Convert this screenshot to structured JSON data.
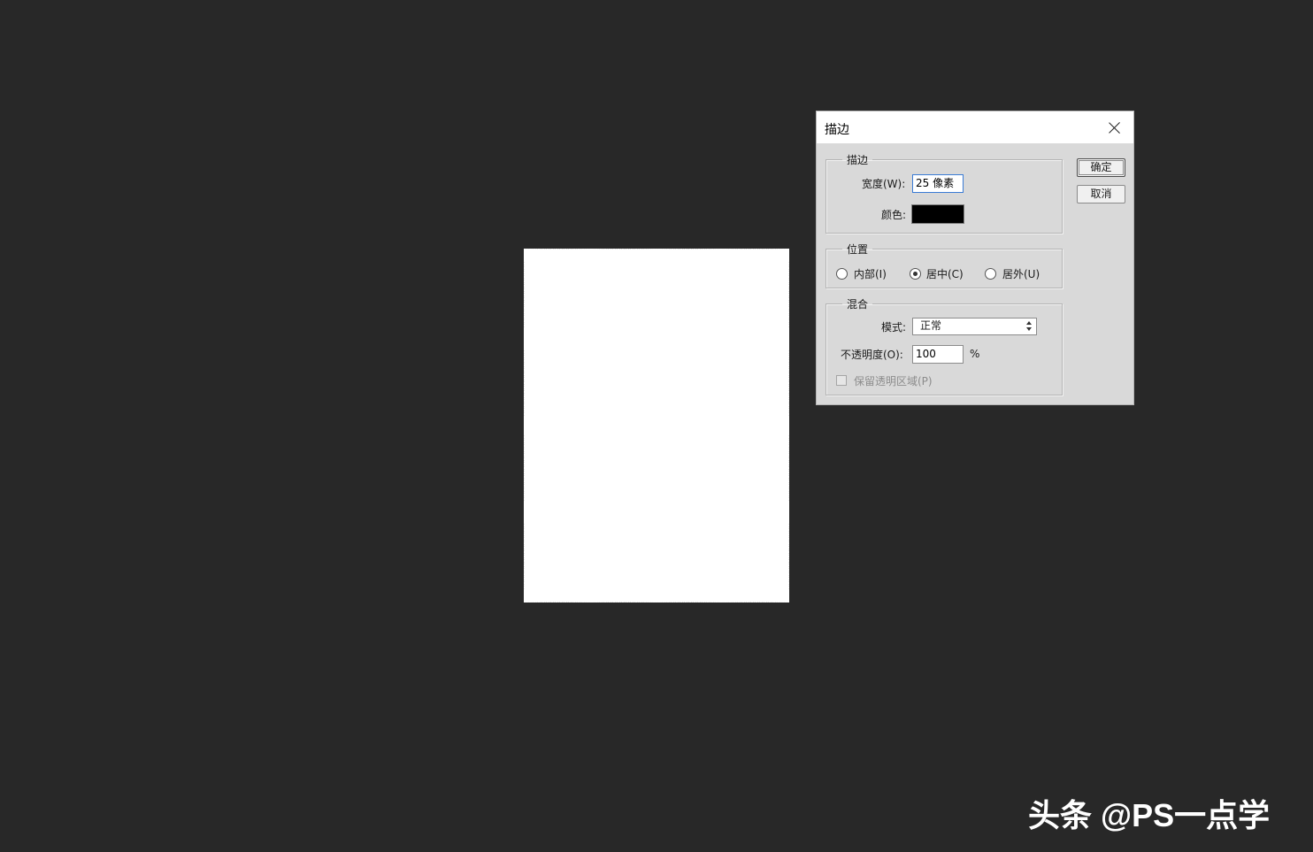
{
  "canvas": {
    "background_color": "#282828",
    "document_color": "#ffffff"
  },
  "dialog": {
    "title": "描边",
    "close_icon": "close-icon",
    "stroke_group": {
      "legend": "描边",
      "width_label": "宽度(W):",
      "width_value": "25 像素",
      "color_label": "颜色:",
      "color_value": "#000000"
    },
    "position_group": {
      "legend": "位置",
      "options": [
        {
          "label": "内部(I)",
          "checked": false
        },
        {
          "label": "居中(C)",
          "checked": true
        },
        {
          "label": "居外(U)",
          "checked": false
        }
      ]
    },
    "blend_group": {
      "legend": "混合",
      "mode_label": "模式:",
      "mode_value": "正常",
      "opacity_label": "不透明度(O):",
      "opacity_value": "100",
      "opacity_unit": "%",
      "preserve_transparency_label": "保留透明区域(P)",
      "preserve_transparency_checked": false,
      "preserve_transparency_enabled": false
    },
    "buttons": {
      "ok": "确定",
      "cancel": "取消"
    }
  },
  "watermark": {
    "text": "头条 @PS一点学"
  }
}
